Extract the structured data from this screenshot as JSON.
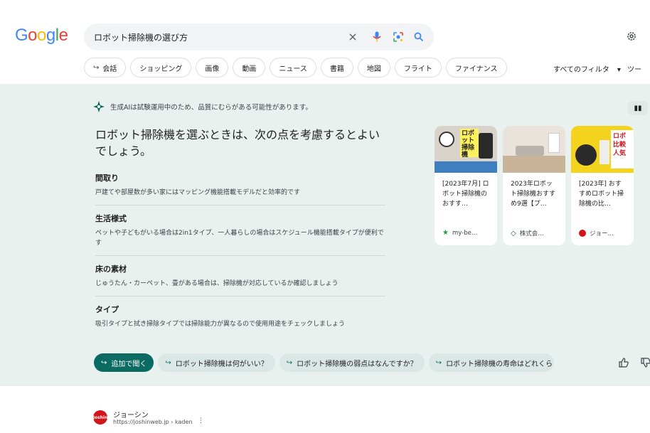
{
  "logo": {
    "letters": [
      "G",
      "o",
      "o",
      "g",
      "l",
      "e"
    ]
  },
  "search": {
    "query": "ロボット掃除機の選び方"
  },
  "chips": [
    {
      "label": "会話",
      "icon": "reply-arrow-icon"
    },
    {
      "label": "ショッピング"
    },
    {
      "label": "画像"
    },
    {
      "label": "動画"
    },
    {
      "label": "ニュース"
    },
    {
      "label": "書籍"
    },
    {
      "label": "地図"
    },
    {
      "label": "フライト"
    },
    {
      "label": "ファイナンス"
    }
  ],
  "filters": {
    "all_filters": "すべてのフィルタ",
    "chevron": "▾",
    "tools": "ツー"
  },
  "ai_overview": {
    "notice": "生成AIは試験運用中のため、品質にむらがある可能性があります。",
    "headline": "ロボット掃除機を選ぶときは、次の点を考慮するとよいでしょう。",
    "sections": [
      {
        "title": "間取り",
        "body": "戸建てや部屋数が多い家にはマッピング機能搭載モデルだと効率的です"
      },
      {
        "title": "生活様式",
        "body": "ペットや子どもがいる場合は2in1タイプ、一人暮らしの場合はスケジュール機能搭載タイプが便利です"
      },
      {
        "title": "床の素材",
        "body": "じゅうたん・カーペット、畳がある場合は、掃除機が対応しているか確認しましょう"
      },
      {
        "title": "タイプ",
        "body": "吸引タイプと拭き掃除タイプでは掃除能力が異なるので使用用途をチェックしましょう"
      }
    ],
    "cards": [
      {
        "title": "[2023年7月] ロボット掃除機のおすす…",
        "source": "my-be…",
        "img_text": "ロボット掃除機"
      },
      {
        "title": "2023年ロボット掃除機おすすめ9選【プ…",
        "source": "株式会…",
        "img_text": ""
      },
      {
        "title": "[2023年] おすすめロボット掃除機の比…",
        "source": "ジョー…",
        "img_text": "ロボ 比較 人気"
      }
    ],
    "followups": [
      {
        "label": "追加で聞く"
      },
      {
        "label": "ロボット掃除機は何がいい？"
      },
      {
        "label": "ロボット掃除機の弱点はなんですか？"
      },
      {
        "label": "ロボット掃除機の寿命はどれくら"
      }
    ]
  },
  "result": {
    "site_name": "ジョーシン",
    "url": "https://joshinweb.jp › kaden",
    "favicon_text": "Joshin"
  },
  "colors": {
    "accent": "#0b6a62",
    "ai_bg": "#e9f1ef",
    "blue": "#4285f4",
    "red": "#ea4335",
    "yellow": "#fbbc05",
    "green": "#34a853"
  }
}
